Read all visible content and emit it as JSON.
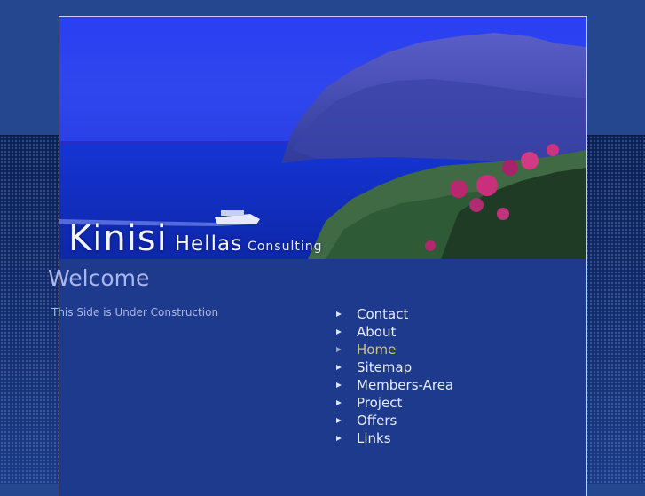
{
  "brand": {
    "name": "Kinisi",
    "name2": "Hellas",
    "tagline": "Consulting"
  },
  "main": {
    "heading": "Welcome",
    "notice": "This Side is Under Construction"
  },
  "nav": {
    "items": [
      {
        "label": "Contact",
        "active": false
      },
      {
        "label": "About",
        "active": false
      },
      {
        "label": "Home",
        "active": true
      },
      {
        "label": "Sitemap",
        "active": false
      },
      {
        "label": "Members-Area",
        "active": false
      },
      {
        "label": "Project",
        "active": false
      },
      {
        "label": "Offers",
        "active": false
      },
      {
        "label": "Links",
        "active": false
      }
    ],
    "bullet_icon": "triangle-right-icon"
  },
  "colors": {
    "page_bg": "#1e3a8c",
    "nav_text": "#e6ebff",
    "nav_active": "#c9c38e",
    "heading": "#a9b7ee"
  }
}
